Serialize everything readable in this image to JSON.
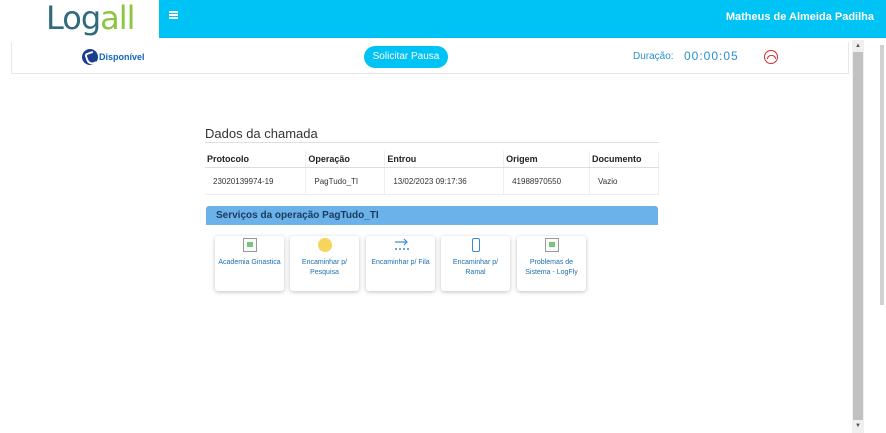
{
  "header": {
    "logo_main": "Log",
    "logo_accent": "all",
    "username": "Matheus de Almeida Padilha"
  },
  "agent_bar": {
    "status": "Disponível",
    "pause_button": "Solicitar Pausa",
    "duration_label": "Duração:",
    "duration_value": "00:00:05"
  },
  "call_data": {
    "title": "Dados da chamada",
    "columns": [
      "Protocolo",
      "Operação",
      "Entrou",
      "Origem",
      "Documento"
    ],
    "row": [
      "23020139974-19",
      "PagTudo_TI",
      "13/02/2023 09:17:36",
      "41988970550",
      "Vazio"
    ]
  },
  "services": {
    "title": "Serviços da operação PagTudo_TI",
    "items": [
      {
        "label": "Academia Ginastica",
        "icon": "image-placeholder-icon"
      },
      {
        "label": "Encaminhar p/ Pesquisa",
        "icon": "smiley-icon"
      },
      {
        "label": "Encaminhar p/ Fila",
        "icon": "queue-arrow-icon"
      },
      {
        "label": "Encaminhar p/ Ramal",
        "icon": "phone-extension-icon"
      },
      {
        "label": "Problemas de Sistema - LogFly",
        "icon": "image-placeholder-icon"
      }
    ]
  },
  "colors": {
    "topbar": "#00c3f5",
    "service_header": "#6cb2ea",
    "accent_text": "#2a8fcf",
    "hangup": "#d32f2f"
  }
}
